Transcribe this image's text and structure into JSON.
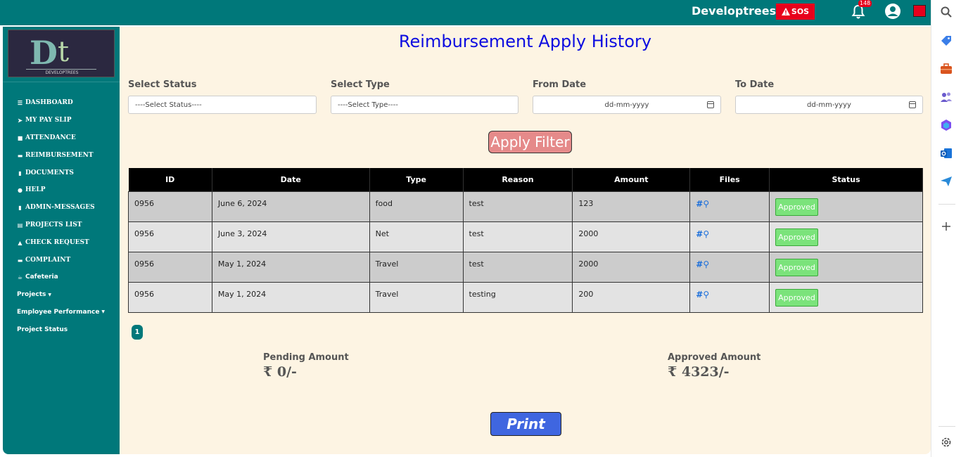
{
  "header": {
    "brand": "Developtrees",
    "sos_label": "SOS",
    "notification_count": "148"
  },
  "sidebar": {
    "logo_text": "DEVELOPTREES",
    "items": [
      {
        "label": "DASHBOARD",
        "icon": "bars-icon"
      },
      {
        "label": "MY PAY SLIP",
        "icon": "paper-plane-icon"
      },
      {
        "label": "ATTENDANCE",
        "icon": "briefcase-icon"
      },
      {
        "label": "REIMBURSEMENT",
        "icon": "credit-card-icon"
      },
      {
        "label": "DOCUMENTS",
        "icon": "file-icon"
      },
      {
        "label": "HELP",
        "icon": "question-icon"
      },
      {
        "label": "ADMIN-MESSAGES",
        "icon": "file-icon"
      },
      {
        "label": "PROJECTS LIST",
        "icon": "list-icon"
      },
      {
        "label": "CHECK REQUEST",
        "icon": "bell-icon"
      },
      {
        "label": "COMPLAINT",
        "icon": "credit-card-icon"
      },
      {
        "label": "Cafeteria",
        "icon": "coffee-icon"
      },
      {
        "label": "Projects",
        "icon": ""
      },
      {
        "label": "Employee Performance",
        "icon": ""
      },
      {
        "label": "Project Status",
        "icon": ""
      }
    ]
  },
  "page": {
    "title": "Reimbursement Apply History"
  },
  "filters": {
    "status_label": "Select Status",
    "status_value": "----Select Status----",
    "type_label": "Select Type",
    "type_value": "----Select Type----",
    "from_label": "From Date",
    "from_placeholder": "dd-mm-yyyy",
    "to_label": "To Date",
    "to_placeholder": "dd-mm-yyyy",
    "apply_label": "Apply Filter"
  },
  "table": {
    "columns": [
      "ID",
      "Date",
      "Type",
      "Reason",
      "Amount",
      "Files",
      "Status"
    ],
    "rows": [
      {
        "id": "0956",
        "date": "June 6, 2024",
        "type": "food",
        "reason": "test",
        "amount": "123",
        "files": "#",
        "status": "Approved"
      },
      {
        "id": "0956",
        "date": "June 3, 2024",
        "type": "Net",
        "reason": "test",
        "amount": "2000",
        "files": "#",
        "status": "Approved"
      },
      {
        "id": "0956",
        "date": "May 1, 2024",
        "type": "Travel",
        "reason": "test",
        "amount": "2000",
        "files": "#",
        "status": "Approved"
      },
      {
        "id": "0956",
        "date": "May 1, 2024",
        "type": "Travel",
        "reason": "testing",
        "amount": "200",
        "files": "#",
        "status": "Approved"
      }
    ]
  },
  "pagination": {
    "current": "1"
  },
  "summary": {
    "pending_label": "Pending Amount",
    "pending_value": "0/-",
    "approved_label": "Approved Amount",
    "approved_value": "4323/-",
    "currency_symbol": "₹"
  },
  "print_label": "Print",
  "colors": {
    "teal": "#00787a",
    "title_blue": "#0c0ce0",
    "sos_red": "#e8001c",
    "approved_green": "#7be37b",
    "print_blue": "#3f66e0",
    "apply_pink": "#e58a8a"
  }
}
